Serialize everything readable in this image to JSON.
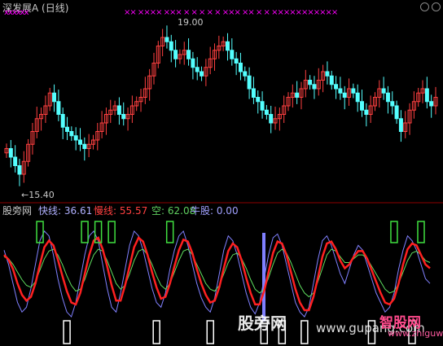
{
  "title": "深发展A (日线)",
  "markers_left": "xxxxxx",
  "markers_right": "×× ××××  ××× ×  ×  ×      ×   ×   ××× ××    ×     ×   ×××××××××××",
  "indicator": {
    "name": "股旁网",
    "fast_label": "快线: 36.61",
    "slow_label": "慢线: 55.57",
    "empty_label": "空: 62.08",
    "bull_label": "牛股: 0.00"
  },
  "watermark": {
    "text1": "股旁网",
    "text2": "www.gupang.com",
    "logo_top": "智股网",
    "logo_bottom": "www.zhiguwang"
  },
  "colors": {
    "up": "#ff4040",
    "down": "#54ffff",
    "fast": "#8080ff",
    "slow": "#ff2020",
    "empty": "#60e060",
    "box_green": "#40e040",
    "box_white": "#ffffff",
    "grid": "#8b0000"
  },
  "chart_data": [
    {
      "type": "candlestick",
      "title": "深发展A (日线)",
      "price_high_label": "19.00",
      "price_low_label": "←15.40",
      "high": 19.0,
      "low": 15.4,
      "close": [
        16.2,
        16.0,
        15.8,
        15.6,
        15.9,
        16.3,
        16.6,
        16.9,
        17.0,
        17.2,
        17.5,
        17.3,
        17.0,
        16.7,
        16.6,
        16.5,
        16.4,
        16.3,
        16.2,
        16.3,
        16.4,
        16.6,
        16.8,
        17.0,
        17.1,
        17.2,
        17.0,
        16.9,
        17.0,
        17.2,
        17.3,
        17.4,
        17.6,
        17.9,
        18.2,
        18.6,
        18.8,
        18.7,
        18.5,
        18.3,
        18.4,
        18.5,
        18.3,
        18.1,
        18.0,
        17.9,
        18.1,
        18.3,
        18.5,
        18.6,
        18.7,
        18.5,
        18.3,
        18.2,
        18.0,
        17.9,
        17.6,
        17.4,
        17.3,
        17.1,
        17.0,
        16.8,
        16.9,
        17.0,
        17.2,
        17.4,
        17.5,
        17.4,
        17.6,
        17.8,
        17.7,
        17.6,
        17.8,
        18.0,
        17.9,
        17.7,
        17.6,
        17.5,
        17.4,
        17.6,
        17.5,
        17.3,
        17.1,
        17.0,
        17.2,
        17.4,
        17.6,
        17.5,
        17.3,
        17.2,
        16.9,
        16.6,
        16.8,
        17.1,
        17.3,
        17.5,
        17.6,
        17.3,
        17.2,
        17.4
      ]
    },
    {
      "type": "line",
      "series": [
        {
          "name": "快线",
          "last": 36.61
        },
        {
          "name": "慢线",
          "last": 55.57
        },
        {
          "name": "空",
          "last": 62.08
        },
        {
          "name": "牛股",
          "last": 0.0
        }
      ],
      "fast": [
        75,
        60,
        40,
        20,
        10,
        15,
        35,
        60,
        85,
        95,
        90,
        70,
        45,
        25,
        10,
        5,
        20,
        45,
        70,
        90,
        95,
        85,
        60,
        35,
        15,
        10,
        30,
        55,
        80,
        95,
        90,
        75,
        55,
        35,
        20,
        15,
        30,
        55,
        75,
        90,
        95,
        80,
        60,
        40,
        25,
        15,
        10,
        25,
        50,
        75,
        90,
        85,
        70,
        50,
        30,
        15,
        8,
        20,
        45,
        70,
        88,
        92,
        80,
        60,
        40,
        20,
        10,
        5,
        15,
        40,
        65,
        85,
        90,
        80,
        65,
        50,
        40,
        55,
        70,
        80,
        75,
        60,
        45,
        30,
        20,
        10,
        15,
        30,
        55,
        75,
        90,
        85,
        75,
        60,
        45,
        40
      ],
      "slow": [
        70,
        65,
        55,
        40,
        28,
        22,
        26,
        40,
        60,
        78,
        85,
        80,
        65,
        48,
        32,
        20,
        18,
        30,
        50,
        70,
        85,
        88,
        76,
        58,
        38,
        22,
        22,
        38,
        58,
        78,
        88,
        84,
        70,
        52,
        36,
        24,
        26,
        40,
        58,
        75,
        86,
        84,
        72,
        55,
        40,
        28,
        20,
        22,
        36,
        56,
        74,
        82,
        78,
        64,
        46,
        30,
        18,
        18,
        32,
        52,
        72,
        84,
        82,
        70,
        52,
        34,
        20,
        12,
        12,
        26,
        46,
        68,
        82,
        84,
        76,
        64,
        56,
        60,
        68,
        74,
        74,
        66,
        54,
        42,
        30,
        20,
        18,
        24,
        40,
        60,
        76,
        82,
        80,
        70,
        60,
        56
      ],
      "empty": [
        68,
        66,
        60,
        52,
        44,
        38,
        36,
        42,
        54,
        66,
        74,
        76,
        70,
        60,
        48,
        38,
        32,
        34,
        44,
        58,
        70,
        76,
        74,
        64,
        52,
        40,
        34,
        38,
        50,
        64,
        74,
        76,
        70,
        60,
        48,
        38,
        34,
        40,
        52,
        64,
        74,
        76,
        70,
        60,
        50,
        40,
        34,
        32,
        38,
        50,
        62,
        70,
        72,
        66,
        56,
        44,
        34,
        30,
        34,
        46,
        60,
        72,
        76,
        72,
        62,
        50,
        38,
        30,
        26,
        30,
        42,
        56,
        70,
        76,
        74,
        68,
        62,
        62,
        66,
        70,
        70,
        66,
        58,
        50,
        42,
        34,
        30,
        32,
        40,
        52,
        64,
        72,
        74,
        70,
        64,
        62
      ],
      "green_boxes_at": [
        8,
        18,
        21,
        24,
        37,
        87,
        93
      ],
      "white_boxes_at": [
        14,
        34,
        46,
        58,
        62,
        67,
        82,
        91
      ]
    }
  ]
}
